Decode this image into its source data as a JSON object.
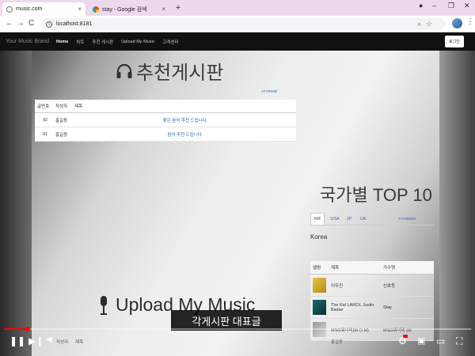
{
  "browser": {
    "tabs": [
      {
        "title": "music.com",
        "close": "×"
      },
      {
        "title": "stay - Google 검색",
        "close": "×"
      }
    ],
    "new_tab": "+",
    "window_controls": [
      "–",
      "❐",
      "✕"
    ],
    "nav": {
      "back": "←",
      "forward": "→",
      "reload": "C"
    },
    "address": "localhost:8181",
    "info": "i"
  },
  "site": {
    "brand": "Your Music Brand",
    "nav": [
      "Home",
      "차트",
      "추천 게시판",
      "Upload My Music",
      "고객센터"
    ],
    "login": "로그인"
  },
  "board": {
    "title": "추천게시판",
    "more": ">>>more",
    "columns": [
      "글번호",
      "작성자",
      "제목"
    ],
    "rows": [
      {
        "no": "92",
        "author": "홍길동",
        "title": "좋은 음악 추천 드립니다."
      },
      {
        "no": "91",
        "author": "홍길동",
        "title": "음악 추천 드립니다."
      }
    ]
  },
  "country": {
    "title": "국가별 TOP 10",
    "tabs": [
      "KR",
      "USA",
      "JP",
      "UK"
    ],
    "more": ">>>more",
    "selected": "Korea",
    "columns": [
      "앨범",
      "제목",
      "가수명"
    ],
    "rows": [
      {
        "title": "이무진",
        "artist": "신호등"
      },
      {
        "title": "The Kid LAROI, Justin Bieber",
        "artist": "Stay"
      },
      {
        "title": "MSG워너비(M.O.M)",
        "artist": "MSG워너비 (M"
      }
    ]
  },
  "upload": {
    "title": "Upload My Music"
  },
  "video": {
    "subtitle": "각게시판 대표글",
    "time": "0:04 / 1:43",
    "progress": 0.05,
    "below": [
      "작성자",
      "제목",
      "홍길동"
    ]
  },
  "icons": [
    "headphone-icon",
    "mic-icon",
    "play-pause-icon",
    "next-icon",
    "volume-icon",
    "settings-icon",
    "subtitles-icon",
    "theater-icon",
    "fullscreen-icon"
  ],
  "colors": {
    "accent_red": "#ff0000",
    "link_blue": "#3a5fb0",
    "nav_bg": "#111111"
  }
}
